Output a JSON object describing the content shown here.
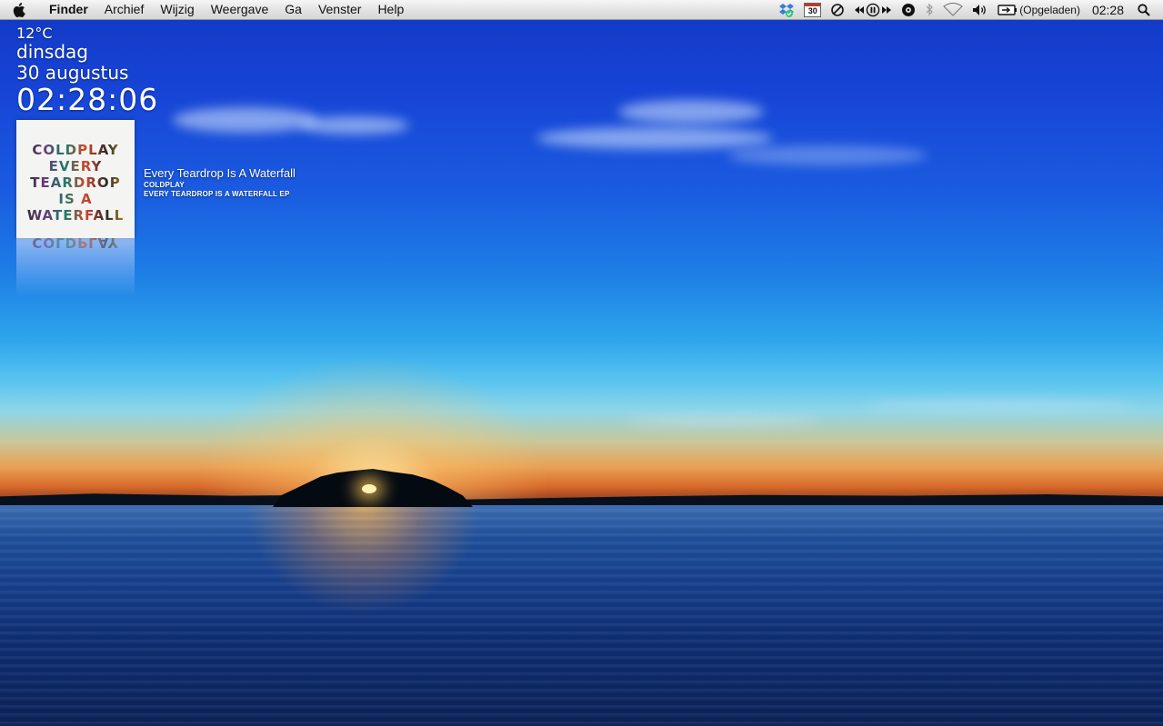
{
  "menubar": {
    "app_name": "Finder",
    "items": [
      "Archief",
      "Wijzig",
      "Weergave",
      "Ga",
      "Venster",
      "Help"
    ],
    "status": {
      "calendar_day": "30",
      "battery_label": "(Opgeladen)",
      "clock": "02:28",
      "icons": [
        "dropbox-icon",
        "calendar-icon",
        "sync-icon",
        "previous-track-icon",
        "pause-icon",
        "next-track-icon",
        "lastfm-icon",
        "bluetooth-icon",
        "wifi-icon",
        "volume-icon",
        "battery-icon",
        "spotlight-icon"
      ]
    }
  },
  "widget": {
    "temperature": "12°C",
    "weekday": "dinsdag",
    "date": "30 augustus",
    "time": "02:28:06"
  },
  "now_playing": {
    "album_art_text": [
      "COLDPLAY",
      "EVERY",
      "TEARDROP",
      "IS A",
      "WATERFALL"
    ],
    "title": "Every Teardrop Is A Waterfall",
    "artist": "COLDPLAY",
    "album": "EVERY TEARDROP IS A WATERFALL EP"
  },
  "colors": {
    "sky_top": "#1238c4",
    "horizon": "#e8a255",
    "water": "#163f8c"
  }
}
